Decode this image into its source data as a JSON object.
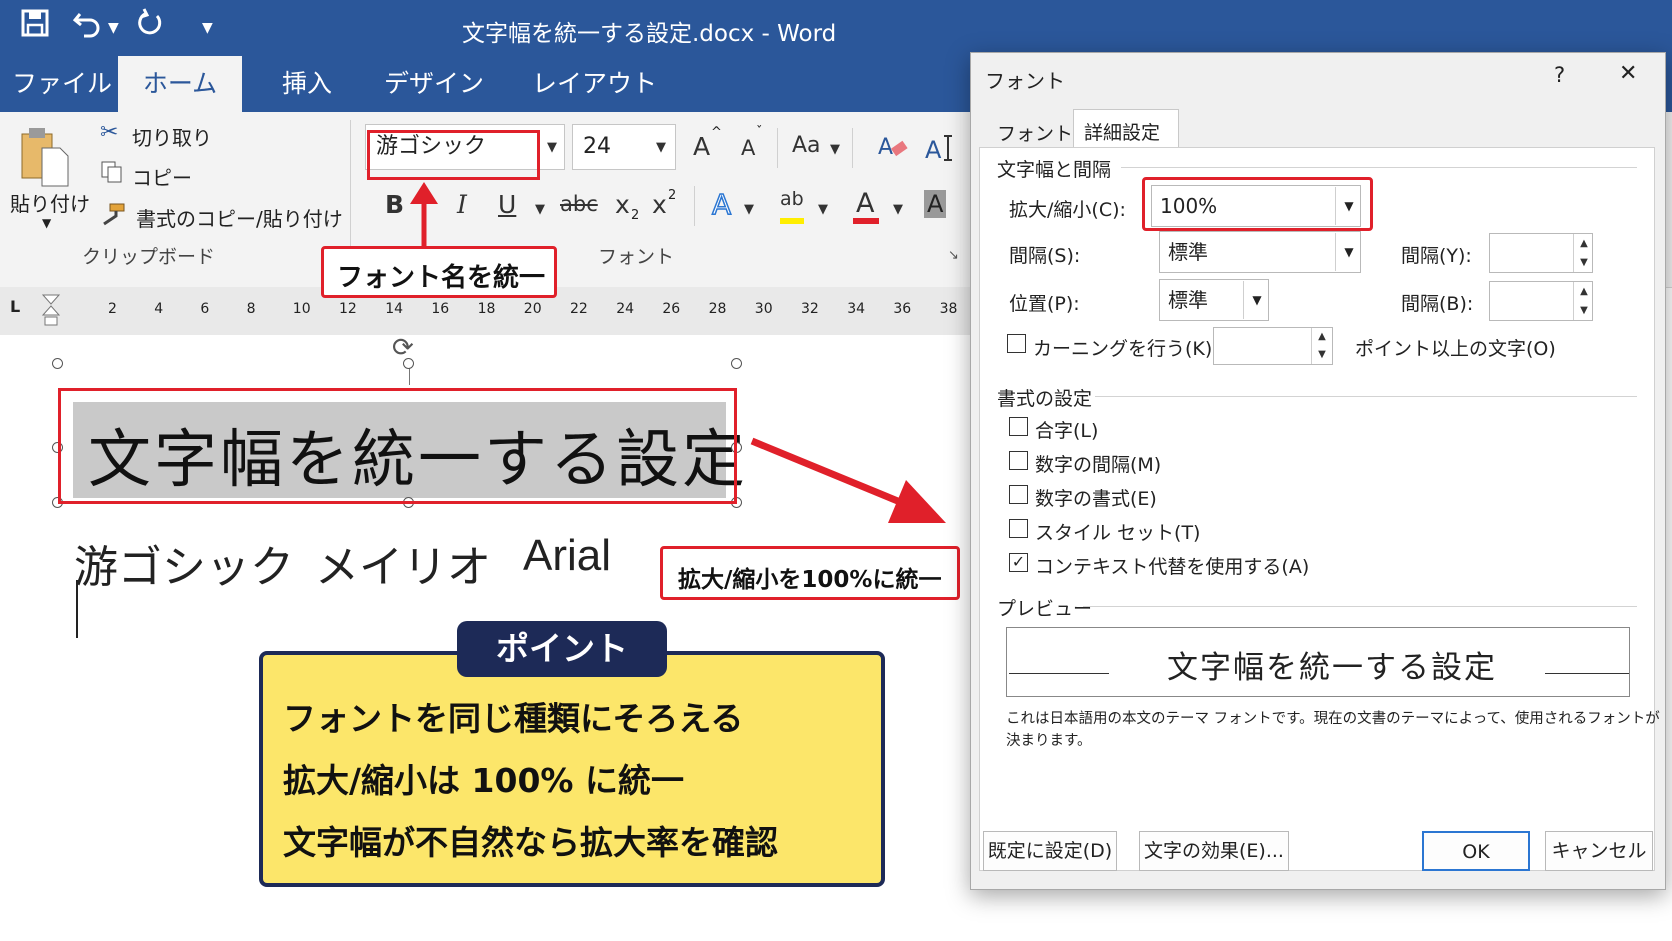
{
  "titlebar": {
    "title": "文字幅を統一する設定.docx  -  Word"
  },
  "tabs": [
    {
      "label": "ファイル"
    },
    {
      "label": "ホーム"
    },
    {
      "label": "挿入"
    },
    {
      "label": "デザイン"
    },
    {
      "label": "レイアウト"
    }
  ],
  "ribbon": {
    "paste": "貼り付け",
    "cut": "切り取り",
    "copy": "コピー",
    "format_painter": "書式のコピー/貼り付け",
    "clipboard_group": "クリップボード",
    "font_name": "游ゴシック",
    "font_size": "24",
    "grow": "A",
    "shrink": "A",
    "change_case": "Aa",
    "bold": "B",
    "italic": "I",
    "underline": "U",
    "strike": "abc",
    "sub": "x",
    "sub_small": "2",
    "sup": "x",
    "sup_small": "2",
    "text_effect": "A",
    "highlight": "ab",
    "font_color": "A",
    "shade": "A",
    "font_group": "フォント"
  },
  "ruler": {
    "tab_marker": "L",
    "numbers": [
      "2",
      "4",
      "6",
      "8",
      "10",
      "12",
      "14",
      "16",
      "18",
      "20",
      "22",
      "24",
      "26",
      "28",
      "30",
      "32",
      "34",
      "36",
      "38"
    ]
  },
  "doc": {
    "heading": "文字幅を統一する設定",
    "fonts_line": [
      "游ゴシック",
      "メイリオ",
      "Arial"
    ]
  },
  "callouts": {
    "font_name": "フォント名を統一",
    "scale": "拡大/縮小を100%に統一"
  },
  "point": {
    "title": "ポイント",
    "lines": [
      "フォントを同じ種類にそろえる",
      "拡大/縮小は 100% に統一",
      "文字幅が不自然なら拡大率を確認"
    ]
  },
  "dialog": {
    "title": "フォント",
    "help": "?",
    "close": "✕",
    "tabs": [
      "フォント",
      "詳細設定"
    ],
    "section_spacing": "文字幅と間隔",
    "scale_label": "拡大/縮小(C):",
    "scale_value": "100%",
    "spacing_label": "間隔(S):",
    "spacing_value": "標準",
    "spacing_by_label": "間隔(Y):",
    "position_label": "位置(P):",
    "position_value": "標準",
    "position_by_label": "間隔(B):",
    "kerning_label": "カーニングを行う(K):",
    "kerning_suffix": "ポイント以上の文字(O)",
    "section_format": "書式の設定",
    "options": [
      {
        "label": "合字(L)",
        "checked": false
      },
      {
        "label": "数字の間隔(M)",
        "checked": false
      },
      {
        "label": "数字の書式(E)",
        "checked": false
      },
      {
        "label": "スタイル セット(T)",
        "checked": false
      },
      {
        "label": "コンテキスト代替を使用する(A)",
        "checked": true
      }
    ],
    "section_preview": "プレビュー",
    "preview_text": "文字幅を統一する設定",
    "note_line1": "これは日本語用の本文のテーマ フォントです。現在の文書のテーマによって、使用されるフォントが",
    "note_line2": "決まります。",
    "btn_default": "既定に設定(D)",
    "btn_effects": "文字の効果(E)...",
    "btn_ok": "OK",
    "btn_cancel": "キャンセル"
  },
  "colors": {
    "word_blue": "#2b579a",
    "callout_red": "#e0202a",
    "point_yellow": "#fce66a",
    "point_navy": "#1d2a57"
  }
}
